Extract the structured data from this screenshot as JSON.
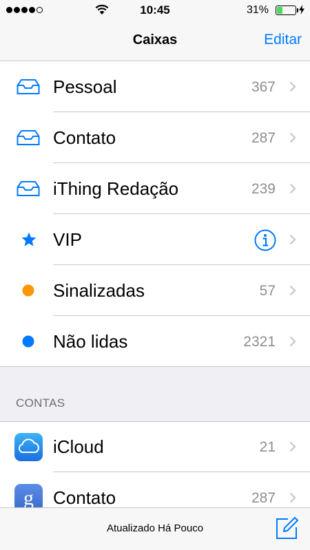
{
  "status_bar": {
    "time": "10:45",
    "battery_percent": "31%",
    "battery_level": 0.31
  },
  "nav": {
    "title": "Caixas",
    "edit_label": "Editar"
  },
  "mailboxes": [
    {
      "label": "Pessoal",
      "count": "367",
      "icon": "inbox-tray-icon"
    },
    {
      "label": "Contato",
      "count": "287",
      "icon": "inbox-tray-icon"
    },
    {
      "label": "iThing Redação",
      "count": "239",
      "icon": "inbox-tray-icon"
    },
    {
      "label": "VIP",
      "count": "",
      "icon": "star-icon"
    },
    {
      "label": "Sinalizadas",
      "count": "57",
      "icon": "orange-dot-icon"
    },
    {
      "label": "Não lidas",
      "count": "2321",
      "icon": "blue-dot-icon"
    }
  ],
  "accounts_section": {
    "title": "CONTAS",
    "items": [
      {
        "label": "iCloud",
        "count": "21",
        "icon": "icloud-icon"
      },
      {
        "label": "Contato",
        "count": "287",
        "icon": "google-icon"
      }
    ]
  },
  "toolbar": {
    "status": "Atualizado Há Pouco"
  },
  "colors": {
    "accent": "#007aff",
    "flag": "#ff9500",
    "separator": "#c8c7cc",
    "muted": "#8e8e93"
  }
}
